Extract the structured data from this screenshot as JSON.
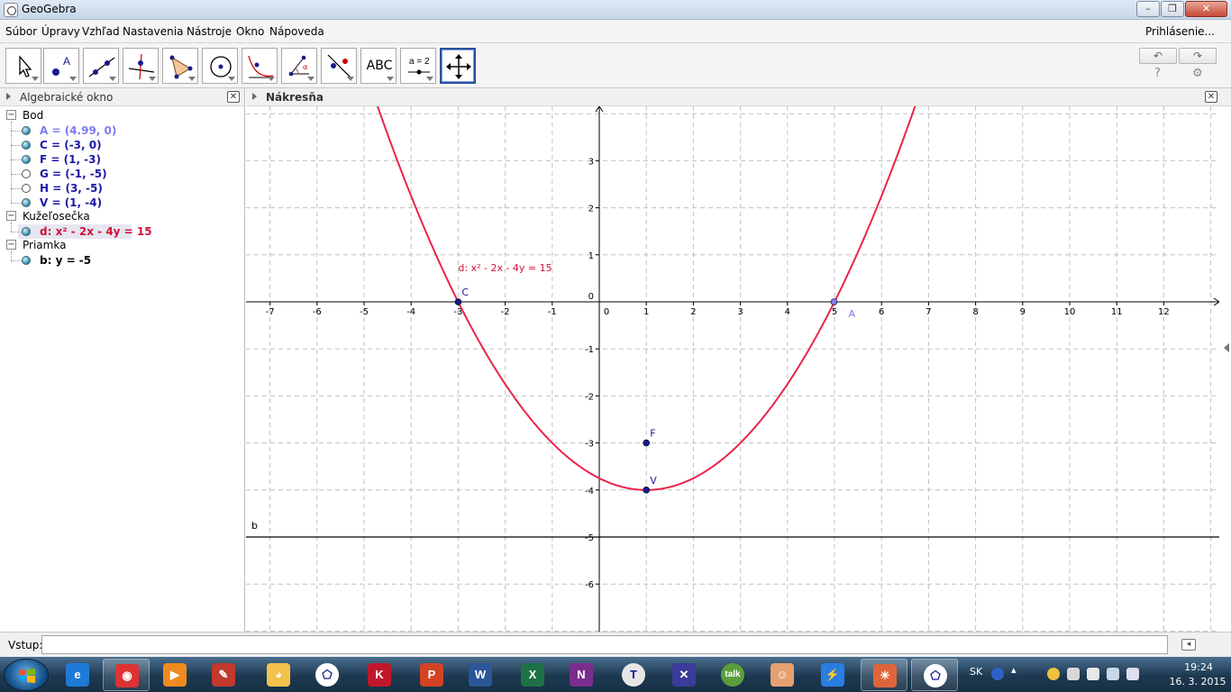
{
  "window": {
    "title": "GeoGebra",
    "min": "–",
    "max": "❐",
    "close": "✕"
  },
  "menu": {
    "items": [
      "Súbor",
      "Úpravy",
      "Vzhľad",
      "Nastavenia",
      "Nástroje",
      "Okno",
      "Nápoveda"
    ],
    "login": "Prihlásenie..."
  },
  "toolbar": {
    "tools": [
      "move-tool",
      "point-tool",
      "line-tool",
      "perpendicular-line-tool",
      "polygon-tool",
      "circle-tool",
      "conic-tool",
      "angle-tool",
      "reflect-tool",
      "text-tool",
      "slider-tool",
      "move-graphics-view-tool"
    ],
    "text_tool_label": "ABC",
    "slider_tool_label": "a = 2",
    "undo": "↶",
    "redo": "↷",
    "help": "?",
    "settings": "⚙"
  },
  "algebra": {
    "title": "Algebraické okno",
    "close": "✕",
    "categories": [
      {
        "name": "Bod",
        "items": [
          {
            "text": "A = (4.99, 0)",
            "color": "#7b7bf0",
            "visible": true
          },
          {
            "text": "C = (-3, 0)",
            "color": "#1a1aa6",
            "visible": true
          },
          {
            "text": "F = (1, -3)",
            "color": "#1a1aa6",
            "visible": true
          },
          {
            "text": "G = (-1, -5)",
            "color": "#1a1aa6",
            "visible": false
          },
          {
            "text": "H = (3, -5)",
            "color": "#1a1aa6",
            "visible": false
          },
          {
            "text": "V = (1, -4)",
            "color": "#1a1aa6",
            "visible": true
          }
        ]
      },
      {
        "name": "Kužeľosečka",
        "items": [
          {
            "text": "d: x² - 2x - 4y = 15",
            "color": "#d0103a",
            "visible": true,
            "selected": true
          }
        ]
      },
      {
        "name": "Priamka",
        "items": [
          {
            "text": "b: y = -5",
            "color": "#000000",
            "visible": true
          }
        ]
      }
    ]
  },
  "graphics": {
    "title": "Nákresňa",
    "close": "✕",
    "x_ticks": [
      "-7",
      "-6",
      "-5",
      "-4",
      "-3",
      "-2",
      "-1",
      "0",
      "1",
      "2",
      "3",
      "4",
      "5",
      "6",
      "7",
      "8",
      "9",
      "10",
      "11",
      "12"
    ],
    "y_ticks": [
      "3",
      "2",
      "1",
      "0",
      "-1",
      "-2",
      "-3",
      "-4",
      "-5",
      "-6"
    ],
    "conic_label": "d: x² - 2x - 4y = 15",
    "line_label": "b",
    "points": [
      {
        "name": "C",
        "x": -3,
        "y": 0,
        "color": "#1a1a8c"
      },
      {
        "name": "A",
        "x": 4.99,
        "y": 0,
        "color": "#7b7bf0"
      },
      {
        "name": "F",
        "x": 1,
        "y": -3,
        "color": "#1a1a8c"
      },
      {
        "name": "V",
        "x": 1,
        "y": -4,
        "color": "#1a1a8c"
      }
    ],
    "conic_color": "#e8254a",
    "line_y": -5
  },
  "input": {
    "label": "Vstup:",
    "value": "",
    "help": "◂"
  },
  "taskbar": {
    "apps": [
      "internet-explorer",
      "chrome",
      "media-player",
      "ccleaner",
      "paint",
      "geogebra-pinned",
      "kaspersky",
      "powerpoint",
      "word",
      "excel",
      "onenote",
      "tex-editor",
      "vlc-mix",
      "google-talk",
      "faces",
      "flashget",
      "firefox-like",
      "geogebra-running"
    ],
    "lang": "SK",
    "time": "19:24",
    "date": "16. 3. 2015"
  }
}
